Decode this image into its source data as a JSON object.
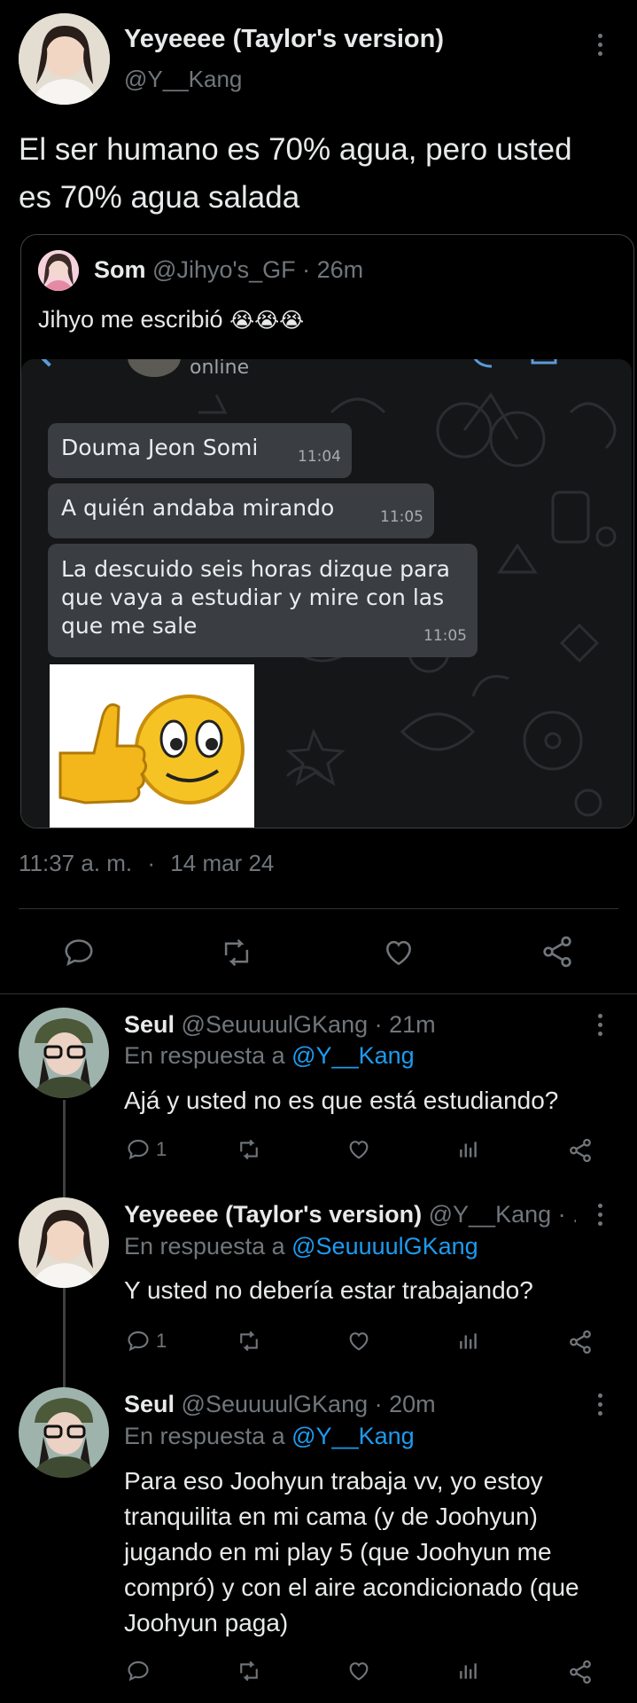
{
  "main_tweet": {
    "author_name": "Yeyeeee (Taylor's version)",
    "handle": "@Y__Kang",
    "text": "El ser humano es 70% agua, pero usted es 70% agua salada",
    "timestamp": "11:37 a. m.",
    "separator": "·",
    "date": "14 mar 24"
  },
  "quoted_tweet": {
    "author_name": "Som",
    "handle": "@Jihyo's_GF",
    "time": "· 26m",
    "text": "Jihyo me escribió",
    "emoji": "😭😭😭",
    "chat_status": "online",
    "messages": [
      {
        "text": "Douma Jeon Somi",
        "time": "11:04"
      },
      {
        "text": "A quién andaba mirando",
        "time": "11:05"
      },
      {
        "text": "La descuido seis horas dizque para que vaya a estudiar y mire con las que me sale",
        "time": "11:05"
      }
    ]
  },
  "replies": [
    {
      "author_name": "Seul",
      "handle": "@SeuuuulGKang",
      "time": "· 21m",
      "reply_prefix": "En respuesta a",
      "reply_to": "@Y__Kang",
      "text": "Ajá y usted no es que está estudiando?",
      "reply_count": "1"
    },
    {
      "author_name": "Yeyeeee (Taylor's version)",
      "handle": "@Y__Kang",
      "time": "· ...",
      "reply_prefix": "En respuesta a",
      "reply_to": "@SeuuuulGKang",
      "text": "Y usted no debería estar trabajando?",
      "reply_count": "1"
    },
    {
      "author_name": "Seul",
      "handle": "@SeuuuulGKang",
      "time": "· 20m",
      "reply_prefix": "En respuesta a",
      "reply_to": "@Y__Kang",
      "text": "Para eso Joohyun trabaja vv, yo estoy tranquilita en mi cama (y de Joohyun) jugando en mi play 5 (que Joohyun me compró) y con el aire acondicionado (que Joohyun paga)",
      "reply_count": ""
    }
  ],
  "colors": {
    "background": "#000000",
    "text": "#e7e9ea",
    "muted": "#71767b",
    "accent": "#1d9bf0"
  }
}
